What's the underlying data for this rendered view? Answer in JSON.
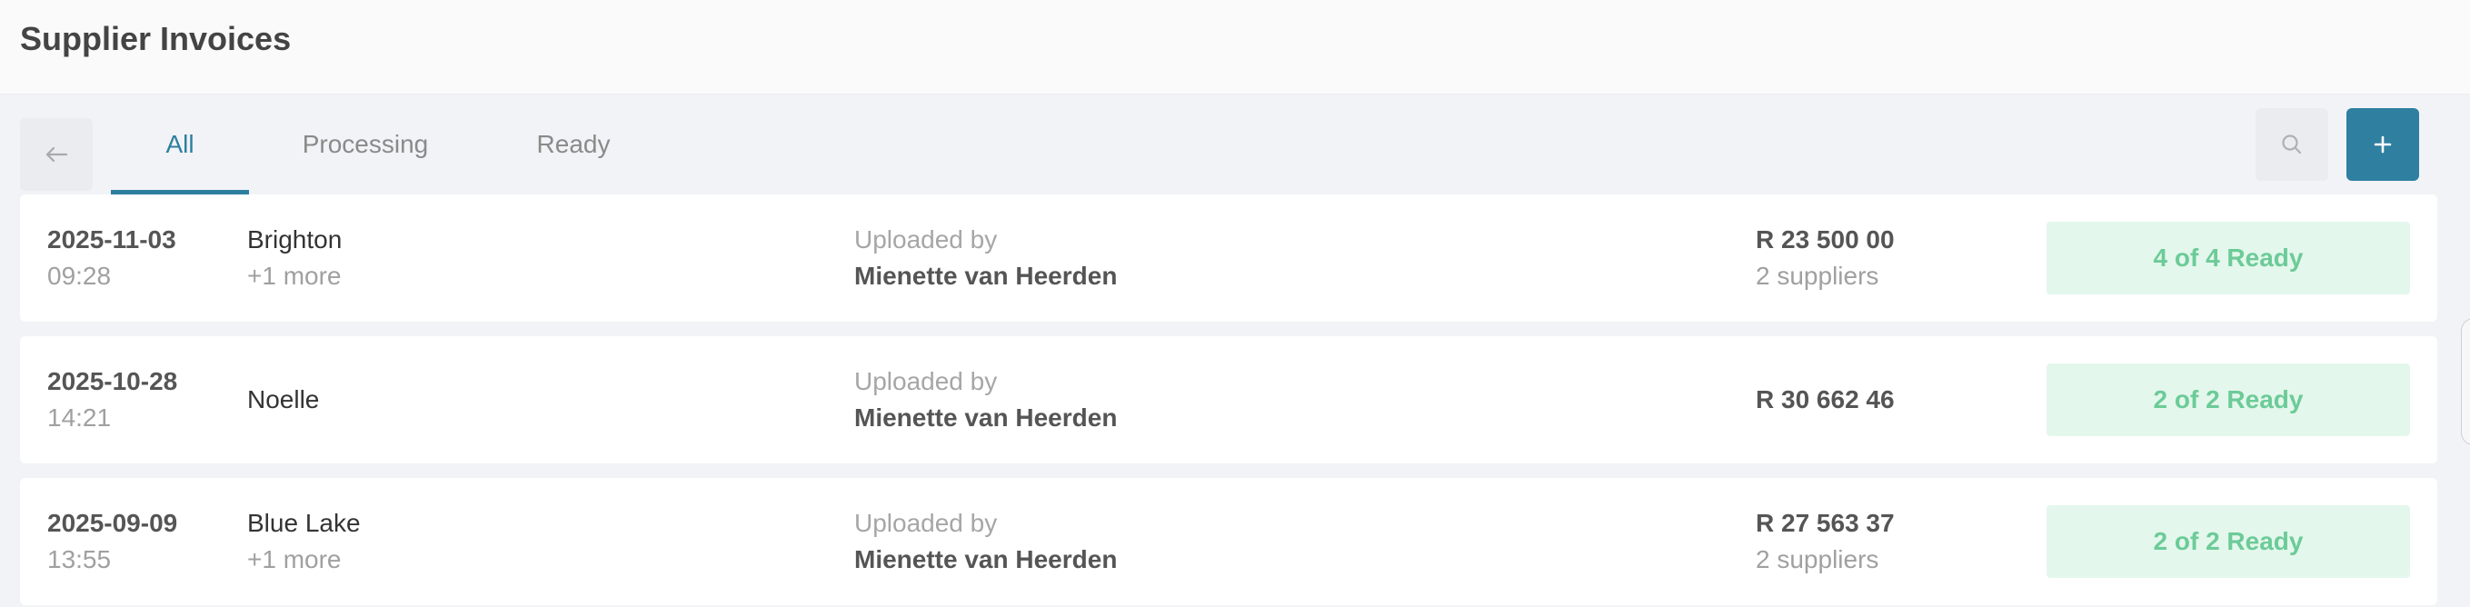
{
  "header": {
    "title": "Supplier Invoices"
  },
  "tabs": [
    {
      "label": "All",
      "active": true
    },
    {
      "label": "Processing",
      "active": false
    },
    {
      "label": "Ready",
      "active": false
    }
  ],
  "toolbar": {
    "back_icon": "arrow-left-icon",
    "search_icon": "search-icon",
    "add_icon": "plus-icon"
  },
  "colors": {
    "accent": "#2e7fa0",
    "status_bg": "#e4f7ec",
    "status_text": "#6ccb98"
  },
  "invoices": [
    {
      "date": "2025-11-03",
      "time": "09:28",
      "name": "Brighton",
      "more": "+1 more",
      "uploaded_label": "Uploaded by",
      "uploaded_by": "Mienette van Heerden",
      "amount": "R 23 500 00",
      "suppliers": "2 suppliers",
      "status": "4 of 4 Ready"
    },
    {
      "date": "2025-10-28",
      "time": "14:21",
      "name": "Noelle",
      "uploaded_label": "Uploaded by",
      "uploaded_by": "Mienette van Heerden",
      "amount": "R 30 662 46",
      "status": "2 of 2 Ready"
    },
    {
      "date": "2025-09-09",
      "time": "13:55",
      "name": "Blue Lake",
      "more": "+1 more",
      "uploaded_label": "Uploaded by",
      "uploaded_by": "Mienette van Heerden",
      "amount": "R 27 563 37",
      "suppliers": "2 suppliers",
      "status": "2 of 2 Ready"
    }
  ]
}
